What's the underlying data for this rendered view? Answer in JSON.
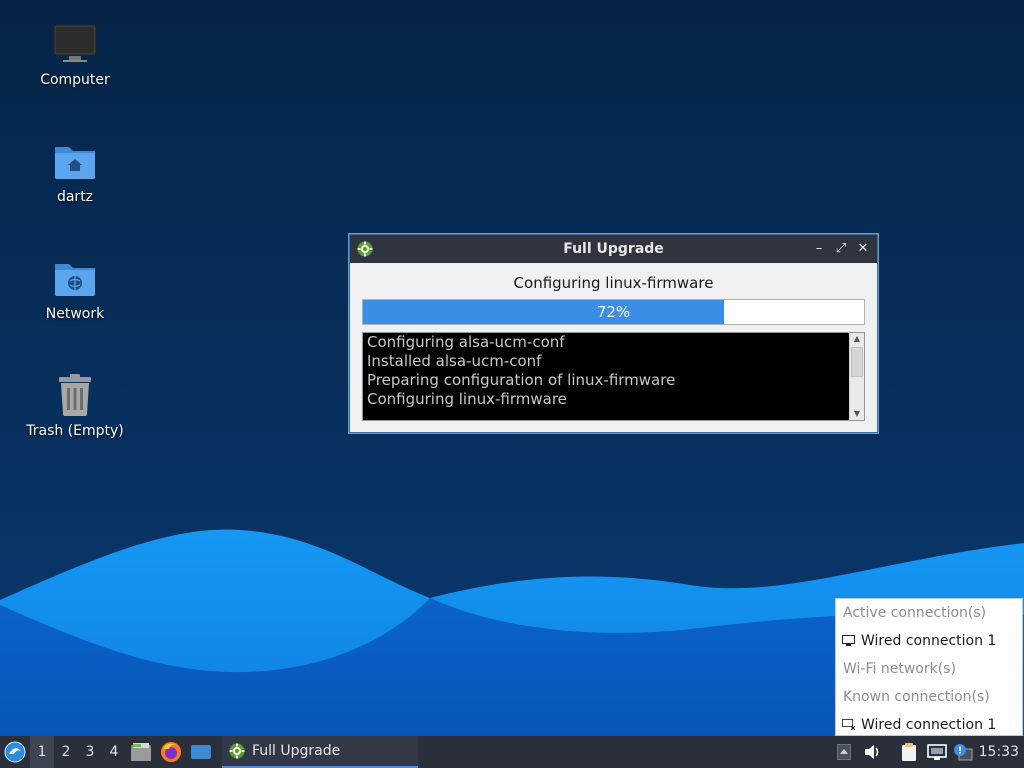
{
  "desktop": {
    "icons": [
      {
        "label": "Computer",
        "icon": "computer-icon"
      },
      {
        "label": "dartz",
        "icon": "home-folder-icon"
      },
      {
        "label": "Network",
        "icon": "network-folder-icon"
      },
      {
        "label": "Trash (Empty)",
        "icon": "trash-icon"
      }
    ]
  },
  "dialog": {
    "title": "Full Upgrade",
    "status": "Configuring linux-firmware",
    "progress": {
      "value_percent": 72,
      "text": "72%"
    },
    "log_lines": [
      "Configuring alsa-ucm-conf",
      "Installed alsa-ucm-conf",
      "Preparing configuration of linux-firmware",
      "Configuring linux-firmware"
    ],
    "buttons": {
      "minimize": "–",
      "maximize": "⤢",
      "close": "✕"
    }
  },
  "network_menu": {
    "active_header": "Active connection(s)",
    "active_item": "Wired connection 1",
    "wifi_header": "Wi-Fi network(s)",
    "known_header": "Known connection(s)",
    "known_item": "Wired connection 1"
  },
  "taskbar": {
    "desktops": [
      "1",
      "2",
      "3",
      "4"
    ],
    "active_desktop": "1",
    "task_label": "Full Upgrade",
    "clock": "15:33"
  },
  "colors": {
    "accent": "#3b8ee6",
    "wallpaper_dark": "#062447",
    "wave_light": "#1e8ff0",
    "wave_dark": "#0b5ec4",
    "taskbar": "#2a2f3a"
  }
}
